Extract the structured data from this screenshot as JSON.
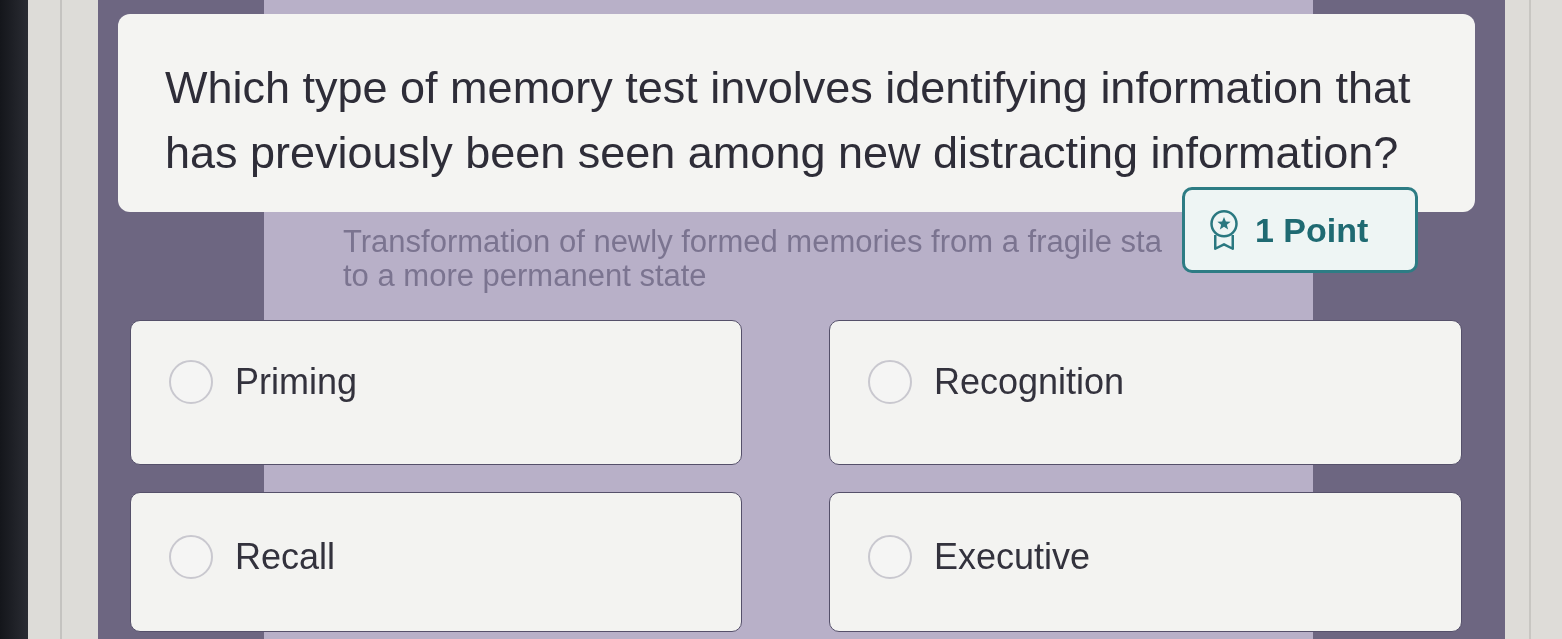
{
  "question": {
    "text": "Which type of memory test involves identifying information that has previously been seen among new distracting information?"
  },
  "hint": {
    "lines": [
      "Transformation of newly formed memories from a fragile sta",
      "to a more permanent state"
    ]
  },
  "points_badge": {
    "label": "1 Point"
  },
  "options": [
    {
      "label": "Priming",
      "selected": false
    },
    {
      "label": "Recognition",
      "selected": false
    },
    {
      "label": "Recall",
      "selected": false
    },
    {
      "label": "Executive",
      "selected": false
    }
  ]
}
